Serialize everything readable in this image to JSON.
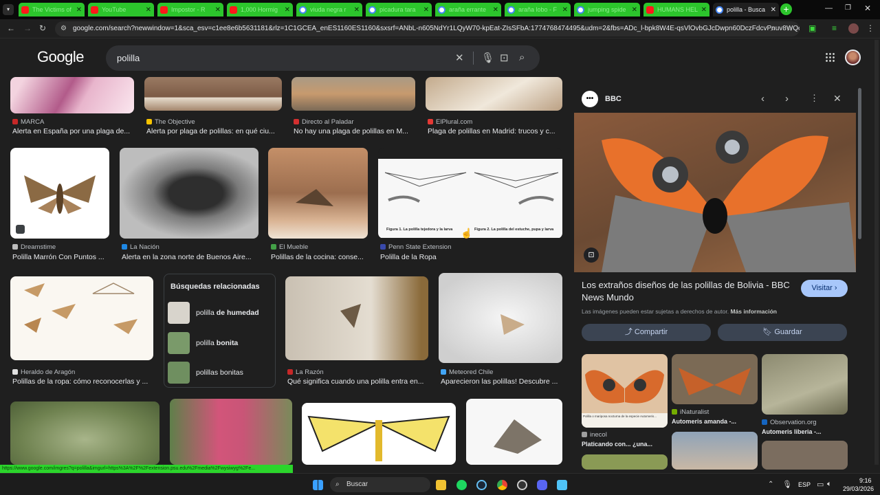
{
  "tabs": [
    {
      "title": "The Victims of",
      "icon": "yt"
    },
    {
      "title": "YouTube",
      "icon": "yt"
    },
    {
      "title": "Impostor - R",
      "icon": "yt"
    },
    {
      "title": "1,000 Hormig",
      "icon": "yt"
    },
    {
      "title": "viuda negra r",
      "icon": "g"
    },
    {
      "title": "picadura tara",
      "icon": "g"
    },
    {
      "title": "araña errante",
      "icon": "g"
    },
    {
      "title": "araña lobo - F",
      "icon": "g"
    },
    {
      "title": "jumping spide",
      "icon": "g"
    },
    {
      "title": "HUMANS HEL",
      "icon": "yt"
    },
    {
      "title": "polilla - Busca",
      "icon": "g"
    }
  ],
  "browser": {
    "url": "google.com/search?newwindow=1&sca_esv=c1ee8e6b5631181&rlz=1C1GCEA_enES1160ES1160&sxsrf=ANbL-n605NdYr1LQyW70-kpEat-ZIsSFbA:1774768474495&udm=2&fbs=ADc_l-bpk8W4E-qsVlOvbGJcDwpn60DczFdcvPnuv8WQohHLTa...",
    "status_url": "https://www.google.com/imgres?q=polilla&imgurl=https%3A%2F%2Fextension.psu.edu%2Fmedia%2Fwysiwyg%2Fe..."
  },
  "google": {
    "logo": "Google",
    "query": "polilla"
  },
  "results": {
    "row1": [
      {
        "source": "MARCA",
        "caption": "Alerta en España por una plaga de...",
        "color": "#c62828"
      },
      {
        "source": "The Objective",
        "caption": "Alerta por plaga de polillas: en qué ciu...",
        "color": "#f9c400"
      },
      {
        "source": "Directo al Paladar",
        "caption": "No hay una plaga de polillas en M...",
        "color": "#d32f2f"
      },
      {
        "source": "ElPlural.com",
        "caption": "Plaga de polillas en Madrid: trucos y c...",
        "color": "#e53935"
      }
    ],
    "row2": [
      {
        "source": "Dreamstime",
        "caption": "Polilla Marrón Con Puntos ...",
        "color": "#bdbdbd"
      },
      {
        "source": "La Nación",
        "caption": "Alerta en la zona norte de Buenos Aire...",
        "color": "#1e88e5"
      },
      {
        "source": "El Mueble",
        "caption": "Polillas de la cocina: conse...",
        "color": "#43a047"
      },
      {
        "source": "Penn State Extension",
        "caption": "Polilla de la Ropa",
        "color": "#3949ab"
      }
    ],
    "figure_labels": [
      "Figura 1. La polilla tejedora y la larva",
      "Figura 2. La polilla del estuche, pupa y larva"
    ],
    "row3": [
      {
        "source": "Heraldo de Aragón",
        "caption": "Polillas de la ropa: cómo reconocerlas y ...",
        "color": "#e0e0e0"
      },
      {
        "source": "La Razón",
        "caption": "Qué significa cuando una polilla entra en...",
        "color": "#c62828"
      },
      {
        "source": "Meteored Chile",
        "caption": "Aparecieron las polillas! Descubre ...",
        "color": "#42a5f5"
      }
    ]
  },
  "related": {
    "heading": "Búsquedas relacionadas",
    "items": [
      {
        "plain": "polilla ",
        "bold": "de humedad"
      },
      {
        "plain": "polilla ",
        "bold": "bonita"
      },
      {
        "plain": "polillas bonitas",
        "bold": ""
      }
    ]
  },
  "panel": {
    "source": "BBC",
    "title_line1": "Los extraños diseños de las polillas de Bolivia - BBC",
    "title_line2": "News Mundo",
    "visit": "Visitar",
    "notice": "Las imágenes pueden estar sujetas a derechos de autor.",
    "more_info": "Más información",
    "share": "Compartir",
    "save": "Guardar",
    "thumbs": [
      {
        "source": "inecol",
        "caption": "Platicando con... ¿una...",
        "color": "#9e9e9e"
      },
      {
        "source": "iNaturalist",
        "caption": "Automeris amanda -...",
        "color": "#74ac00"
      },
      {
        "source": "Observation.org",
        "caption": "Automeris liberia -...",
        "color": "#1565c0"
      }
    ],
    "thumb_small_text": "Polilla o mariposa nocturna de la especie Automeris..."
  },
  "taskbar": {
    "search": "Buscar",
    "lang": "ESP",
    "time": "9:16",
    "date": "29/03/2026"
  }
}
